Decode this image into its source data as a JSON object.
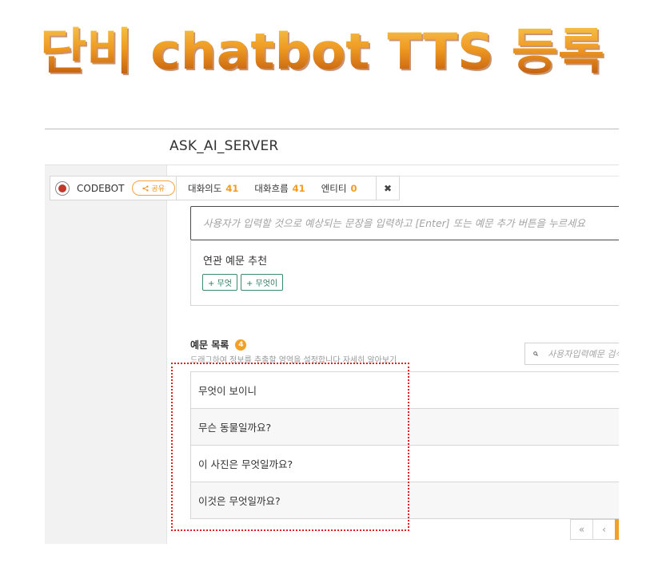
{
  "banner": {
    "title": "단비 chatbot TTS 등록"
  },
  "header": {
    "server_name": "ASK_AI_SERVER"
  },
  "toolbar": {
    "brand_name": "CODEBOT",
    "share_label": "공유",
    "stats": [
      {
        "label": "대화의도",
        "value": "41"
      },
      {
        "label": "대화흐름",
        "value": "41"
      },
      {
        "label": "엔티티",
        "value": "0"
      }
    ],
    "close_glyph": "✖"
  },
  "entry": {
    "placeholder": "사용자가 입력할 것으로 예상되는 문장을 입력하고 [Enter] 또는 예문 추가 버튼을 누르세요"
  },
  "recommend": {
    "title": "연관 예문 추천",
    "chips": [
      "+ 무엇",
      "+ 무엇이"
    ]
  },
  "examples": {
    "title": "예문 목록",
    "count": "4",
    "hint": "드래그하여 정보를 추출할 영역을 설정합니다 자세히 알아보기",
    "search_placeholder": "사용자입력예문 검색",
    "items": [
      "무엇이 보이니",
      "무슨 동물일까요?",
      "이 사진은 무엇일까요?",
      "이것은 무엇일까요?"
    ]
  },
  "pagination": {
    "first": "«",
    "prev": "‹"
  },
  "colors": {
    "accent": "#f29c1f",
    "chip_border": "#3a8a70",
    "highlight_border": "#e02020",
    "banner_gradient_top": "#f7c24a",
    "banner_gradient_bottom": "#c0570c"
  }
}
